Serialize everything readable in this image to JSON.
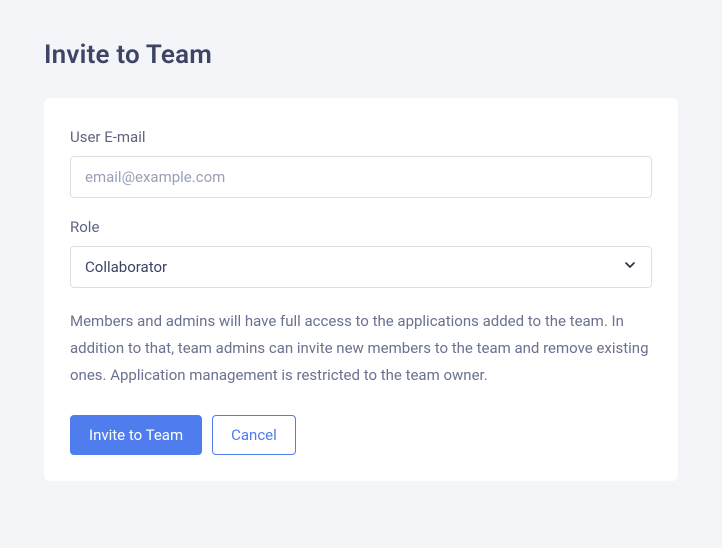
{
  "page": {
    "title": "Invite to Team"
  },
  "form": {
    "email": {
      "label": "User E-mail",
      "placeholder": "email@example.com",
      "value": ""
    },
    "role": {
      "label": "Role",
      "selected": "Collaborator"
    },
    "description": "Members and admins will have full access to the applications added to the team. In addition to that, team admins can invite new members to the team and remove existing ones. Application management is restricted to the team owner."
  },
  "buttons": {
    "submit_label": "Invite to Team",
    "cancel_label": "Cancel"
  }
}
